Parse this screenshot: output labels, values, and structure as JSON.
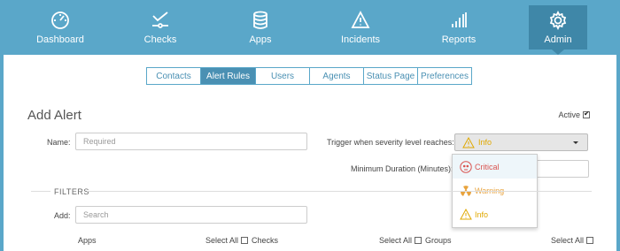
{
  "nav": {
    "items": [
      {
        "label": "Dashboard",
        "icon": "gauge-icon"
      },
      {
        "label": "Checks",
        "icon": "checks-icon"
      },
      {
        "label": "Apps",
        "icon": "database-icon"
      },
      {
        "label": "Incidents",
        "icon": "warning-icon"
      },
      {
        "label": "Reports",
        "icon": "bar-chart-icon"
      },
      {
        "label": "Admin",
        "icon": "gear-icon"
      }
    ],
    "active": "Admin"
  },
  "subtabs": [
    "Contacts",
    "Alert Rules",
    "Users",
    "Agents",
    "Status Page",
    "Preferences"
  ],
  "active_subtab": "Alert Rules",
  "form": {
    "title": "Add Alert",
    "active_label": "Active",
    "active_checked": true,
    "name_label": "Name:",
    "name_placeholder": "Required",
    "trigger_label": "Trigger when severity level reaches:",
    "severity_selected": "Info",
    "min_duration_label": "Minimum Duration (Minutes):",
    "severity_options": [
      {
        "label": "Critical",
        "icon": "skull-icon",
        "color": "#d9534f"
      },
      {
        "label": "Warning",
        "icon": "radiation-icon",
        "color": "#e8a33d"
      },
      {
        "label": "Info",
        "icon": "warning-triangle-icon",
        "color": "#e0a800"
      }
    ]
  },
  "filters": {
    "heading": "FILTERS",
    "add_label": "Add:",
    "search_placeholder": "Search",
    "columns": [
      "Apps",
      "Checks",
      "Groups"
    ],
    "select_all_label": "Select All"
  },
  "colors": {
    "nav_bg": "#5aa7c9",
    "nav_active": "#3f87a8",
    "tab_border": "#5aa7c9",
    "critical": "#d9534f",
    "warning": "#e8a33d",
    "info": "#e0a800"
  }
}
